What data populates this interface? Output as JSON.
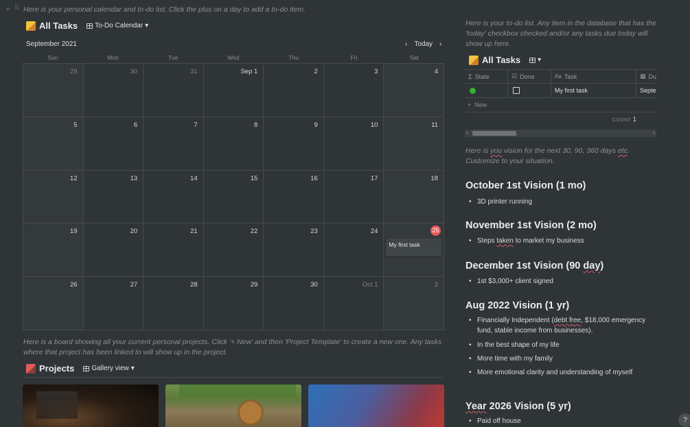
{
  "top_note": "Here is your personal calendar and to-do list. Click the plus on a day to add a to-do item.",
  "calendar": {
    "title": "All Tasks",
    "view": "To-Do Calendar",
    "month": "September 2021",
    "today_label": "Today",
    "weekdays": [
      "Sun",
      "Mon",
      "Tue",
      "Wed",
      "Thu",
      "Fri",
      "Sat"
    ],
    "weeks": [
      [
        "29",
        "30",
        "31",
        "Sep 1",
        "2",
        "3",
        "4"
      ],
      [
        "5",
        "6",
        "7",
        "8",
        "9",
        "10",
        "11"
      ],
      [
        "12",
        "13",
        "14",
        "15",
        "16",
        "17",
        "18"
      ],
      [
        "19",
        "20",
        "21",
        "22",
        "23",
        "24",
        "25"
      ],
      [
        "26",
        "27",
        "28",
        "29",
        "30",
        "Oct 1",
        "2"
      ]
    ],
    "event": "My first task"
  },
  "projects_note": "Here is a board showing all your current personal projects. Click '+ New' and then 'Project Template' to create a new one. Any tasks where that project has been linked to will show up in the project.",
  "projects": {
    "title": "Projects",
    "view": "Gallery view"
  },
  "right": {
    "todo_note": "Here is your to-do list. Any item in the database that has the 'today' checkbox checked and/or any tasks due today will show up here.",
    "table_title": "All Tasks",
    "columns": [
      "State",
      "Done",
      "Task",
      "Du"
    ],
    "row": {
      "task": "My first task",
      "due": "Septe"
    },
    "new_label": "New",
    "count_label": "COUNT",
    "count_value": "1",
    "vision_note_a": "Here is ",
    "vision_note_you": "you",
    "vision_note_b": " vision for the next 30, 90, 360 days ",
    "vision_note_etc": "etc",
    "vision_note_c": ". Customize to your situation.",
    "oct_title": "October 1st Vision (1 mo)",
    "oct_items": [
      "3D printer running"
    ],
    "nov_title": "November 1st Vision (2 mo)",
    "nov_item_a": "Steps ",
    "nov_item_taken": "taken",
    "nov_item_b": " to market my business",
    "dec_title_a": "December 1st Vision (90 ",
    "dec_title_day": "day",
    "dec_title_b": ")",
    "dec_items": [
      "1st $3,000+ client signed"
    ],
    "aug_title": "Aug 2022 Vision (1 yr)",
    "aug_item1_a": "Financially Independent (",
    "aug_item1_debt": "debt free",
    "aug_item1_b": ", $18,000 emergency",
    "aug_item1_c": "fund, stable income from businesses).",
    "aug_items": [
      "In the best shape of my life",
      "More time with my family",
      "More emotional clarity and understanding of myself"
    ],
    "year_title_year": "Year",
    "year_title_rest": " 2026 Vision (5 yr)",
    "year_items": [
      "Paid off house"
    ]
  },
  "help": "?"
}
